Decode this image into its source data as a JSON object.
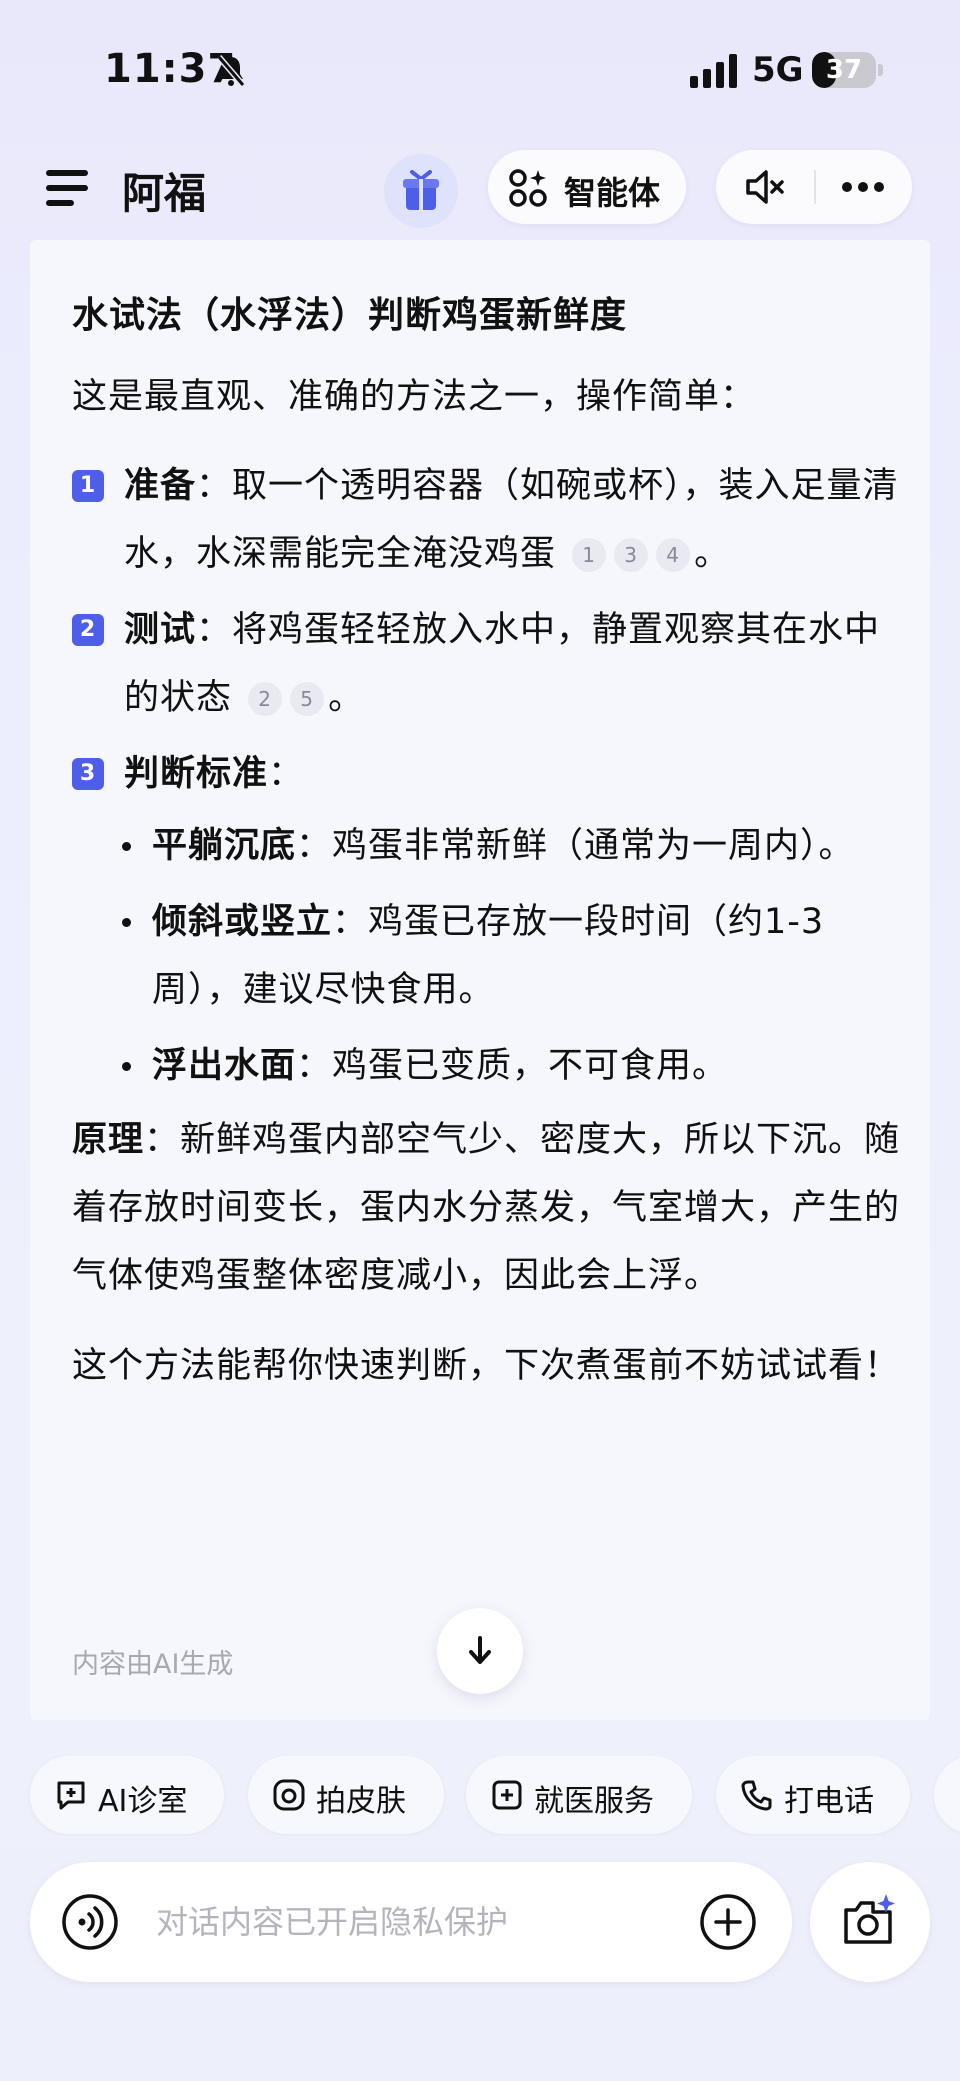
{
  "status_bar": {
    "time": "11:37",
    "network": "5G",
    "battery": "37",
    "battery_level": 0.37
  },
  "header": {
    "agent_name": "阿福",
    "agent_button_label": "智能体"
  },
  "message": {
    "title": "水试法（水浮法）判断鸡蛋新鲜度",
    "intro": "这是最直观、准确的方法之一，操作简单：",
    "steps": [
      {
        "num": "1",
        "label": "准备",
        "text": "：取一个透明容器（如碗或杯），装入足量清水，水深需能完全淹没鸡蛋",
        "cites": [
          "1",
          "3",
          "4"
        ],
        "end": "。"
      },
      {
        "num": "2",
        "label": "测试",
        "text": "：将鸡蛋轻轻放入水中，静置观察其在水中的状态",
        "cites": [
          "2",
          "5"
        ],
        "end": "。"
      },
      {
        "num": "3",
        "label": "判断标准",
        "text": "："
      }
    ],
    "bullets": [
      {
        "label": "平躺沉底",
        "text": "：鸡蛋非常新鲜（通常为一周内）。"
      },
      {
        "label": "倾斜或竖立",
        "text": "：鸡蛋已存放一段时间（约1-3周），建议尽快食用。"
      },
      {
        "label": "浮出水面",
        "text": "：鸡蛋已变质，不可食用。"
      }
    ],
    "principle": {
      "label": "原理",
      "text": "：新鲜鸡蛋内部空气少、密度大，所以下沉。随着存放时间变长，蛋内水分蒸发，气室增大，产生的气体使鸡蛋整体密度减小，因此会上浮。"
    },
    "closing": "这个方法能帮你快速判断，下次煮蛋前不妨试试看！",
    "ai_note": "内容由AI生成"
  },
  "chips": [
    {
      "label": "AI诊室",
      "icon": "chat-plus-icon"
    },
    {
      "label": "拍皮肤",
      "icon": "camera-icon"
    },
    {
      "label": "就医服务",
      "icon": "hospital-icon"
    },
    {
      "label": "打电话",
      "icon": "phone-icon"
    }
  ],
  "input": {
    "placeholder": "对话内容已开启隐私保护"
  },
  "colors": {
    "accent": "#4f5ee9",
    "text": "#111111",
    "muted": "#a8a8b2"
  }
}
